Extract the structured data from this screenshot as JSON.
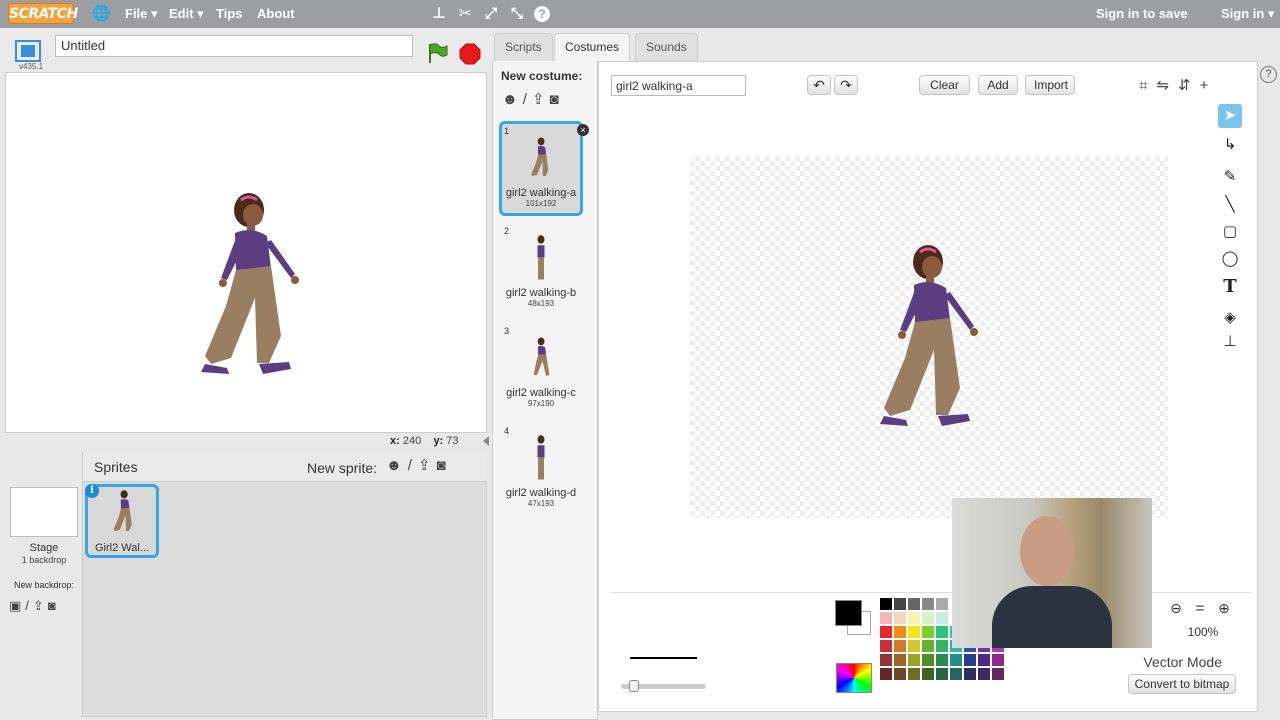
{
  "menubar": {
    "logo": "SCRATCH",
    "menus": [
      {
        "label": "File ▾"
      },
      {
        "label": "Edit ▾"
      },
      {
        "label": "Tips"
      },
      {
        "label": "About"
      }
    ],
    "signin_save": "Sign in to save",
    "signin": "Sign in ▾"
  },
  "stage": {
    "project_title": "Untitled",
    "version": "v435.1",
    "coords": {
      "x_label": "x:",
      "x": "240",
      "y_label": "y:",
      "y": "73"
    }
  },
  "sprites_panel": {
    "title": "Sprites",
    "new_sprite_label": "New sprite:",
    "stage_label": "Stage",
    "stage_backdrops": "1 backdrop",
    "new_backdrop_label": "New backdrop:",
    "sprites": [
      {
        "name": "Girl2 Wal..."
      }
    ]
  },
  "tabs": [
    {
      "label": "Scripts"
    },
    {
      "label": "Costumes"
    },
    {
      "label": "Sounds"
    }
  ],
  "costumes_panel": {
    "new_costume_label": "New costume:",
    "costumes": [
      {
        "num": "1",
        "name": "girl2 walking-a",
        "size": "101x192"
      },
      {
        "num": "2",
        "name": "girl2 walking-b",
        "size": "48x193"
      },
      {
        "num": "3",
        "name": "girl2 walking-c",
        "size": "97x190"
      },
      {
        "num": "4",
        "name": "girl2 walking-d",
        "size": "47x193"
      }
    ]
  },
  "editor": {
    "costume_name": "girl2 walking-a",
    "clear": "Clear",
    "add": "Add",
    "import": "Import",
    "zoom_level": "100%",
    "mode_label": "Vector Mode",
    "convert_button": "Convert to bitmap",
    "fill_color": "#000000",
    "help_icon": "?"
  },
  "palette": [
    [
      "#000000",
      "#444444",
      "#666666",
      "#888888",
      "#aaaaaa"
    ],
    [
      "#f5b6b6",
      "#f7d6b8",
      "#f8f0b5",
      "#d6f2c8",
      "#c8eee2"
    ],
    [
      "#e62828",
      "#f08c14",
      "#f5e614",
      "#7ad228",
      "#28c878",
      "#28c8c8",
      "#2864dc",
      "#7828dc",
      "#d228c8"
    ],
    [
      "#c83232",
      "#d27828",
      "#d2c828",
      "#64b432",
      "#32b464",
      "#32b4b4",
      "#3250b4",
      "#6432b4",
      "#b432b4"
    ],
    [
      "#963232",
      "#a06428",
      "#a0a028",
      "#508c28",
      "#288c50",
      "#288c8c",
      "#283c8c",
      "#50288c",
      "#8c288c"
    ],
    [
      "#642828",
      "#6e4628",
      "#6e6e28",
      "#3c6428",
      "#286440",
      "#286464",
      "#282c64",
      "#3c2864",
      "#642864"
    ]
  ]
}
